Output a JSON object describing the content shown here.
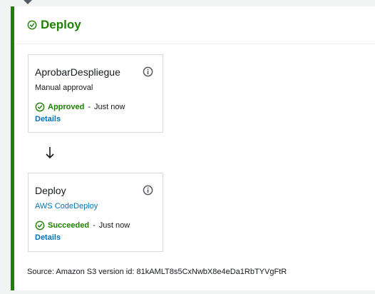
{
  "stage": {
    "title": "Deploy",
    "status_icon": "check-circle-icon",
    "accent_color": "#1d8102"
  },
  "actions": [
    {
      "name": "AprobarDespliegue",
      "subtitle": "Manual approval",
      "status": "Approved",
      "separator": "-",
      "time": "Just now",
      "details_label": "Details",
      "info_icon": "info-icon"
    },
    {
      "name": "Deploy",
      "subtitle": "AWS CodeDeploy",
      "status": "Succeeded",
      "separator": "-",
      "time": "Just now",
      "details_label": "Details",
      "info_icon": "info-icon"
    }
  ],
  "arrow_icon": "arrow-down-icon",
  "source_text": "Source: Amazon S3 version id: 81kAMLT8s5CxNwbX8e4eDa1RbTYVgFtR",
  "colors": {
    "success": "#1d8102",
    "link": "#0073bb",
    "border": "#d5dbdb"
  }
}
